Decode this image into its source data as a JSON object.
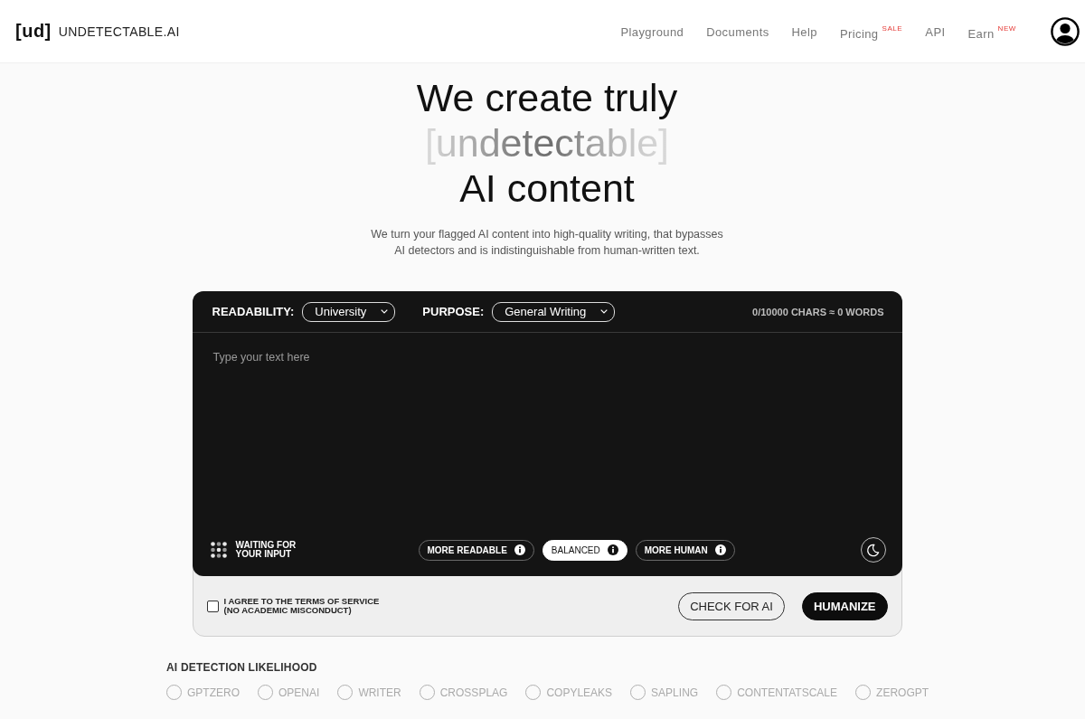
{
  "header": {
    "logo_mark": "[ud]",
    "brand": "UNDETECTABLE.AI",
    "nav": [
      {
        "label": "Playground"
      },
      {
        "label": "Documents"
      },
      {
        "label": "Help"
      },
      {
        "label": "Pricing",
        "tag": "SALE"
      },
      {
        "label": "API"
      },
      {
        "label": "Earn",
        "tag": "NEW"
      }
    ]
  },
  "hero": {
    "title_lines": [
      {
        "text": "We create truly",
        "kind": "plain"
      },
      {
        "text": "[undetectable]",
        "kind": "highlight"
      },
      {
        "text": "AI content",
        "kind": "plain"
      }
    ],
    "subtitle": "We turn your flagged AI content into high-quality writing, that bypasses AI detectors and is indistinguishable from human-written text."
  },
  "editor": {
    "settings": [
      {
        "label": "READABILITY:",
        "value": "University"
      },
      {
        "label": "PURPOSE:",
        "value": "General Writing"
      }
    ],
    "counter": "0/10000 CHARS ≈ 0 WORDS",
    "placeholder": "Type your text here",
    "status": "WAITING FOR YOUR INPUT",
    "modes": [
      {
        "label": "MORE READABLE",
        "selected": false
      },
      {
        "label": "BALANCED",
        "selected": true
      },
      {
        "label": "MORE HUMAN",
        "selected": false
      }
    ],
    "terms": {
      "label": "I AGREE TO THE TERMS OF SERVICE (NO ACADEMIC MISCONDUCT)",
      "checked": false
    },
    "buttons": [
      {
        "label": "CHECK FOR AI",
        "kind": "outline"
      },
      {
        "label": "HUMANIZE",
        "kind": "primary"
      }
    ]
  },
  "detection": {
    "title": "AI DETECTION LIKELIHOOD",
    "detectors": [
      {
        "name": "GPTZERO"
      },
      {
        "name": "OPENAI"
      },
      {
        "name": "WRITER"
      },
      {
        "name": "CROSSPLAG"
      },
      {
        "name": "COPYLEAKS"
      },
      {
        "name": "SAPLING"
      },
      {
        "name": "CONTENTATSCALE"
      },
      {
        "name": "ZEROGPT"
      }
    ]
  }
}
